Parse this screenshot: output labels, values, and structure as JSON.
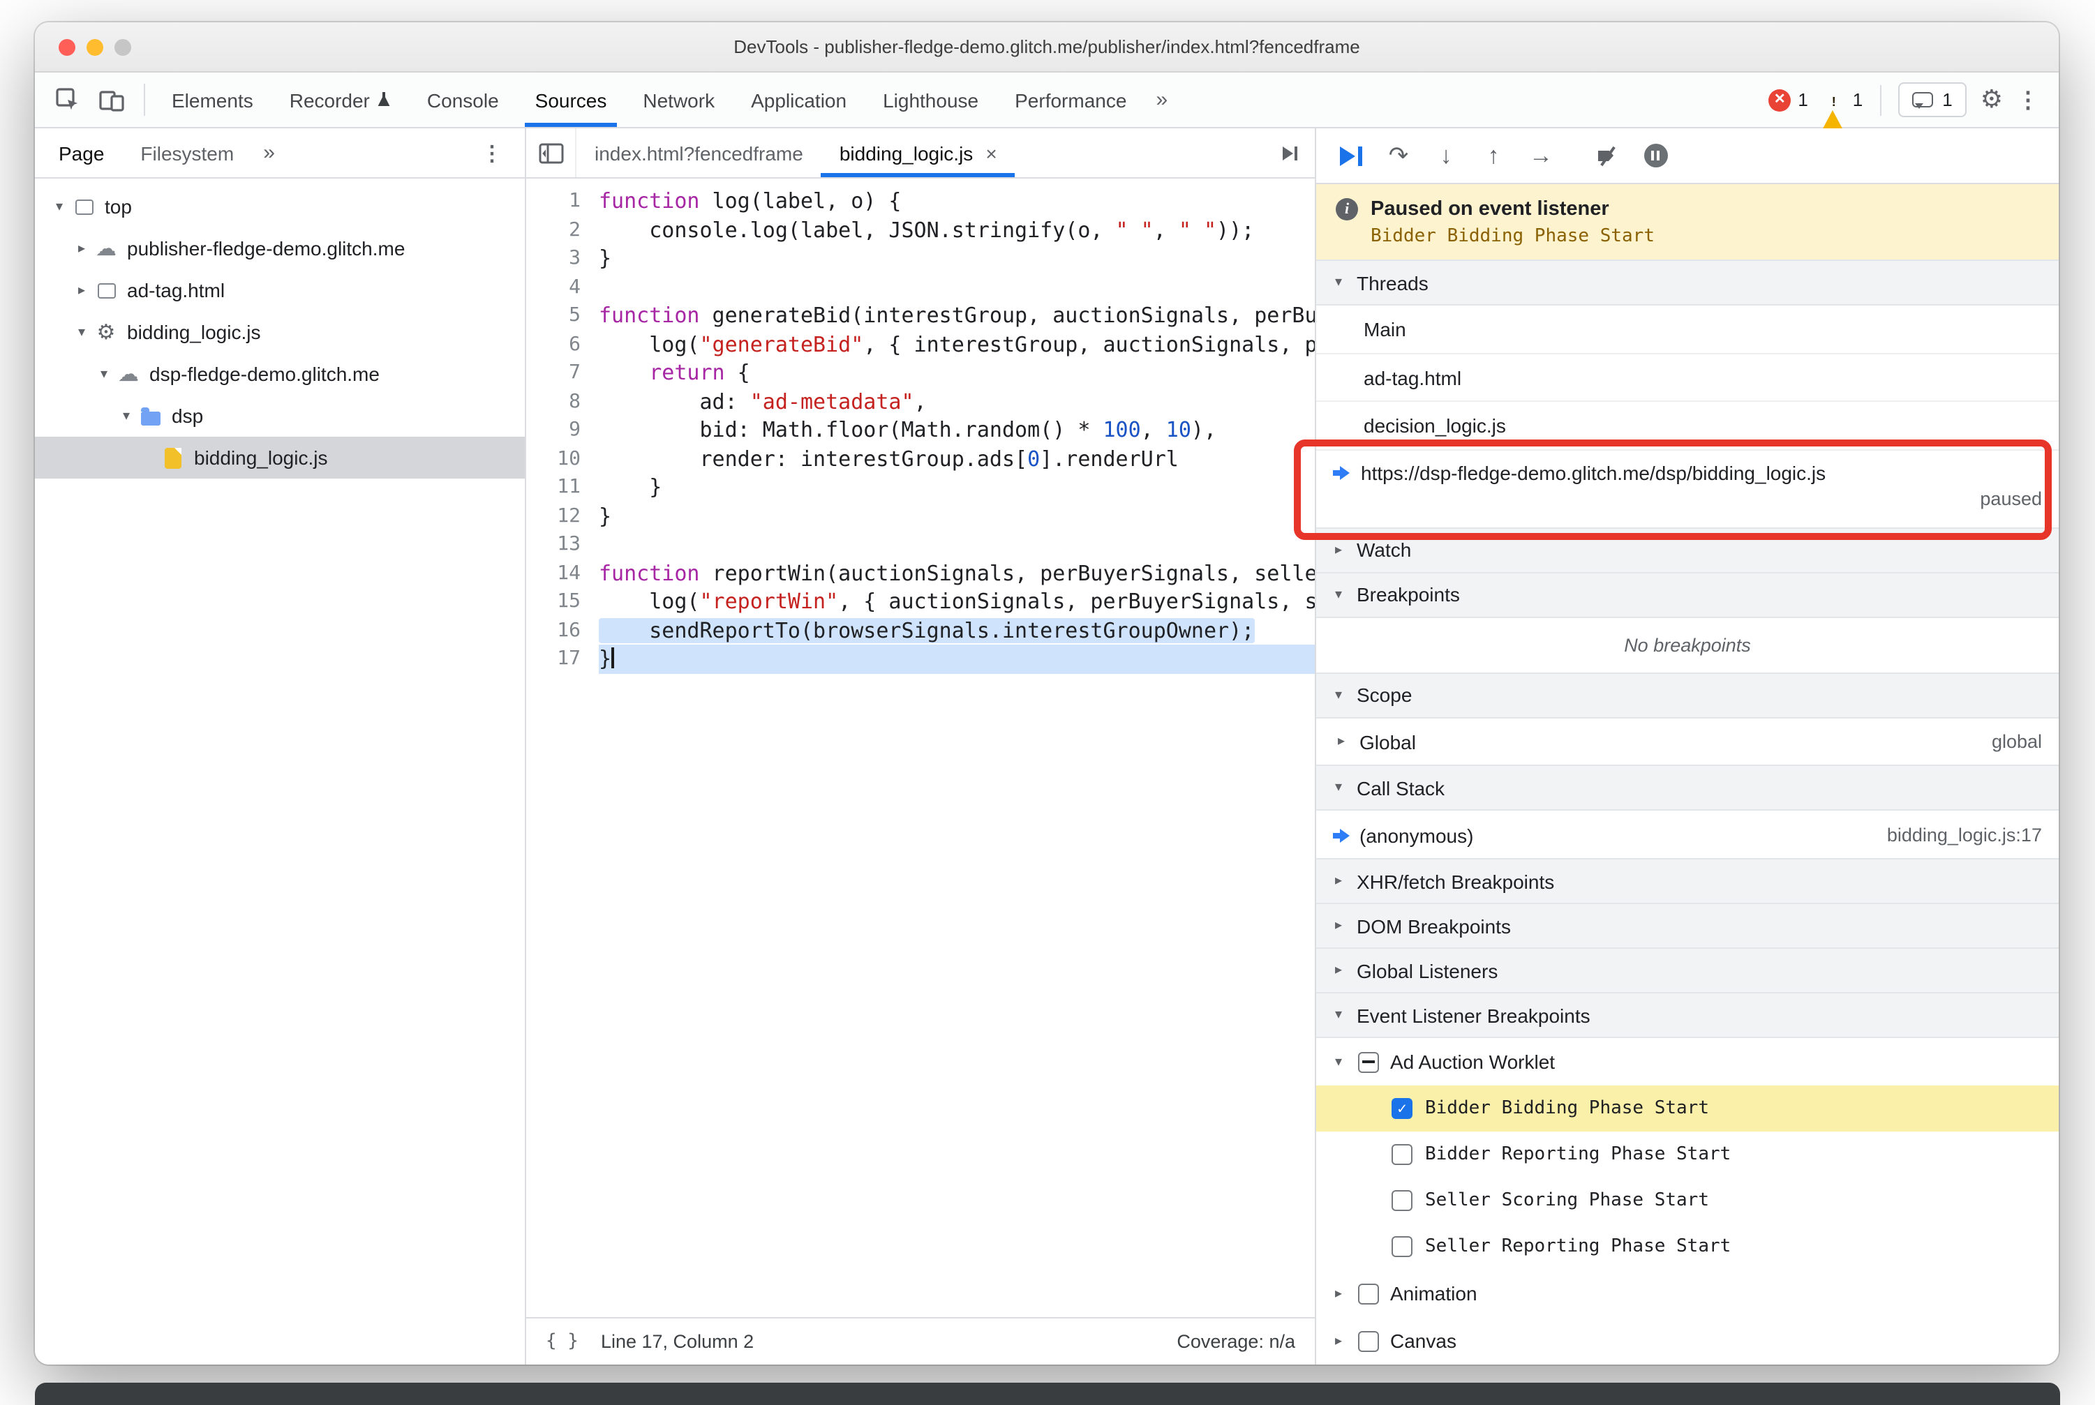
{
  "window": {
    "title": "DevTools - publisher-fledge-demo.glitch.me/publisher/index.html?fencedframe"
  },
  "icons": {
    "expanded_arrow": "▾",
    "collapsed_arrow": "▸",
    "kebab": "⋮",
    "gear": "⚙",
    "more_chevron": "»",
    "close": "×",
    "step_over": "↷",
    "step_into": "↓",
    "step_out": "↑",
    "step": "→",
    "info": "i",
    "braces": "{ }"
  },
  "colors": {
    "accent_blue": "#1a73e8",
    "annotation_red": "#e8352a",
    "paused_banner_bg": "#fdf3cf",
    "active_line_blue": "#cfe3fc",
    "breakpoint_row_yellow": "#fbf0a9"
  },
  "toolbar": {
    "tabs": [
      "Elements",
      "Recorder",
      "Console",
      "Sources",
      "Network",
      "Application",
      "Lighthouse",
      "Performance"
    ],
    "active_tab": "Sources",
    "badges": {
      "errors": "1",
      "warnings": "1",
      "issues": "1"
    }
  },
  "sidebar": {
    "tabs": [
      "Page",
      "Filesystem"
    ],
    "tree": [
      {
        "label": "top",
        "icon": "frame-icon",
        "arrow": "expanded",
        "depth": 0
      },
      {
        "label": "publisher-fledge-demo.glitch.me",
        "icon": "cloud-icon",
        "arrow": "collapsed",
        "depth": 1
      },
      {
        "label": "ad-tag.html",
        "icon": "frame-icon",
        "arrow": "collapsed",
        "depth": 1
      },
      {
        "label": "bidding_logic.js",
        "icon": "worklet-icon",
        "arrow": "expanded",
        "depth": 1
      },
      {
        "label": "dsp-fledge-demo.glitch.me",
        "icon": "cloud-icon",
        "arrow": "expanded",
        "depth": 2
      },
      {
        "label": "dsp",
        "icon": "folder-icon",
        "arrow": "expanded",
        "depth": 3
      },
      {
        "label": "bidding_logic.js",
        "icon": "js-file-icon",
        "arrow": "none",
        "depth": 4,
        "selected": true
      }
    ]
  },
  "editor": {
    "tabs": [
      {
        "label": "index.html?fencedframe",
        "active": false
      },
      {
        "label": "bidding_logic.js",
        "active": true
      }
    ],
    "status": {
      "braces": "{ }",
      "line_col": "Line 17, Column 2",
      "coverage": "Coverage: n/a"
    },
    "lines": [
      {
        "n": 1,
        "tokens": [
          {
            "c": "k",
            "t": "function"
          },
          {
            "c": "p",
            "t": " log(label, o) {"
          }
        ]
      },
      {
        "n": 2,
        "tokens": [
          {
            "c": "p",
            "t": "    console.log(label, JSON.stringify(o, "
          },
          {
            "c": "s",
            "t": "\" \""
          },
          {
            "c": "p",
            "t": ", "
          },
          {
            "c": "s",
            "t": "\" \""
          },
          {
            "c": "p",
            "t": "));"
          }
        ]
      },
      {
        "n": 3,
        "tokens": [
          {
            "c": "p",
            "t": "}"
          }
        ]
      },
      {
        "n": 4,
        "tokens": []
      },
      {
        "n": 5,
        "tokens": [
          {
            "c": "k",
            "t": "function"
          },
          {
            "c": "p",
            "t": " generateBid(interestGroup, auctionSignals, perBuyerSignals, trustedBiddingSignals, browserSignals) {"
          }
        ]
      },
      {
        "n": 6,
        "tokens": [
          {
            "c": "p",
            "t": "    log("
          },
          {
            "c": "s",
            "t": "\"generateBid\""
          },
          {
            "c": "p",
            "t": ", { interestGroup, auctionSignals, perBuyerSignals, trustedBiddingSignals, browserSignals });"
          }
        ]
      },
      {
        "n": 7,
        "tokens": [
          {
            "c": "p",
            "t": "    "
          },
          {
            "c": "k",
            "t": "return"
          },
          {
            "c": "p",
            "t": " {"
          }
        ]
      },
      {
        "n": 8,
        "tokens": [
          {
            "c": "p",
            "t": "        ad: "
          },
          {
            "c": "s",
            "t": "\"ad-metadata\""
          },
          {
            "c": "p",
            "t": ","
          }
        ]
      },
      {
        "n": 9,
        "tokens": [
          {
            "c": "p",
            "t": "        bid: Math.floor(Math.random() * "
          },
          {
            "c": "n",
            "t": "100"
          },
          {
            "c": "p",
            "t": ", "
          },
          {
            "c": "n",
            "t": "10"
          },
          {
            "c": "p",
            "t": "),"
          }
        ]
      },
      {
        "n": 10,
        "tokens": [
          {
            "c": "p",
            "t": "        render: interestGroup.ads["
          },
          {
            "c": "n",
            "t": "0"
          },
          {
            "c": "p",
            "t": "].renderUrl"
          }
        ]
      },
      {
        "n": 11,
        "tokens": [
          {
            "c": "p",
            "t": "    }"
          }
        ]
      },
      {
        "n": 12,
        "tokens": [
          {
            "c": "p",
            "t": "}"
          }
        ]
      },
      {
        "n": 13,
        "tokens": []
      },
      {
        "n": 14,
        "tokens": [
          {
            "c": "k",
            "t": "function"
          },
          {
            "c": "p",
            "t": " reportWin(auctionSignals, perBuyerSignals, sellerSignals, browserSignals) {"
          }
        ]
      },
      {
        "n": 15,
        "tokens": [
          {
            "c": "p",
            "t": "    log("
          },
          {
            "c": "s",
            "t": "\"reportWin\""
          },
          {
            "c": "p",
            "t": ", { auctionSignals, perBuyerSignals, sellerSignals, browserSignals });"
          }
        ]
      },
      {
        "n": 16,
        "hl": "selection",
        "tokens": [
          {
            "c": "p",
            "t": "    sendReportTo(browserSignals.interestGroupOwner);"
          }
        ]
      },
      {
        "n": 17,
        "hl": "active",
        "caret": true,
        "tokens": [
          {
            "c": "p",
            "t": "}"
          }
        ]
      }
    ]
  },
  "debugger": {
    "banner": {
      "title": "Paused on event listener",
      "subtitle": "Bidder Bidding Phase Start"
    },
    "threads": {
      "title": "Threads",
      "items": [
        {
          "label": "Main"
        },
        {
          "label": "ad-tag.html"
        },
        {
          "label": "decision_logic.js"
        },
        {
          "label": "https://dsp-fledge-demo.glitch.me/dsp/bidding_logic.js",
          "status": "paused",
          "current": true
        }
      ]
    },
    "watch": {
      "title": "Watch"
    },
    "breakpoints": {
      "title": "Breakpoints",
      "empty": "No breakpoints"
    },
    "scope": {
      "title": "Scope",
      "rows": [
        {
          "label": "Global",
          "value": "global"
        }
      ]
    },
    "call_stack": {
      "title": "Call Stack",
      "frames": [
        {
          "name": "(anonymous)",
          "location": "bidding_logic.js:17"
        }
      ]
    },
    "xhr": {
      "title": "XHR/fetch Breakpoints"
    },
    "dom": {
      "title": "DOM Breakpoints"
    },
    "global_listeners": {
      "title": "Global Listeners"
    },
    "event_listener_breakpoints": {
      "title": "Event Listener Breakpoints",
      "groups": [
        {
          "label": "Ad Auction Worklet",
          "checkbox": "indeterminate",
          "arrow": "expanded",
          "children": [
            {
              "label": "Bidder Bidding Phase Start",
              "checked": true,
              "highlighted": true
            },
            {
              "label": "Bidder Reporting Phase Start",
              "checked": false
            },
            {
              "label": "Seller Scoring Phase Start",
              "checked": false
            },
            {
              "label": "Seller Reporting Phase Start",
              "checked": false
            }
          ]
        },
        {
          "label": "Animation",
          "checkbox": "unchecked",
          "arrow": "collapsed",
          "children": []
        },
        {
          "label": "Canvas",
          "checkbox": "unchecked",
          "arrow": "collapsed",
          "children": []
        }
      ]
    }
  }
}
